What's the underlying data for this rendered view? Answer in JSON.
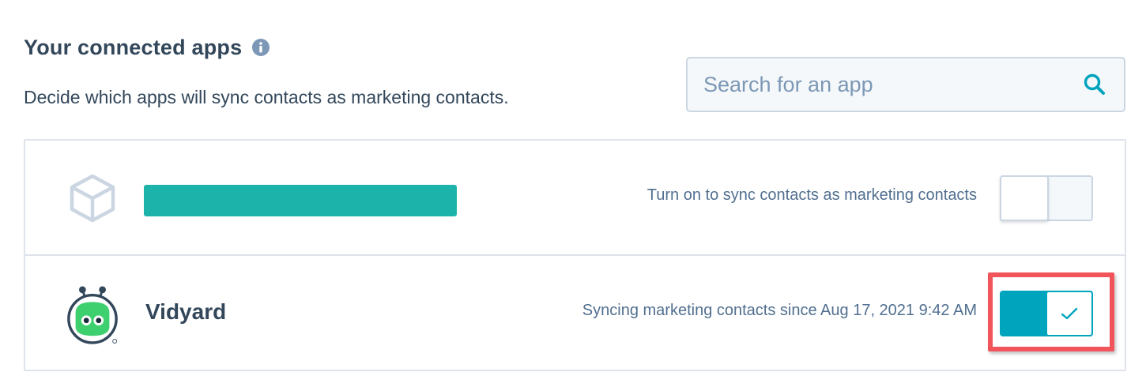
{
  "header": {
    "title": "Your connected apps",
    "info_icon": "info-circle-icon",
    "subtitle": "Decide which apps will sync contacts as marketing contacts."
  },
  "search": {
    "placeholder": "Search for an app",
    "value": "",
    "icon": "search-icon"
  },
  "apps": [
    {
      "name": "",
      "name_redacted": true,
      "redaction_color": "#1cb4aa",
      "logo_icon": "cube-icon",
      "status": "Turn on to sync contacts as marketing contacts",
      "sync_enabled": false
    },
    {
      "name": "Vidyard",
      "logo_icon": "vidyard-robot-icon",
      "status": "Syncing marketing contacts since Aug 17, 2021 9:42 AM",
      "sync_enabled": true,
      "highlighted": true
    }
  ],
  "colors": {
    "text_primary": "#33475b",
    "text_secondary": "#516f90",
    "accent": "#00a4bd",
    "border": "#dfe3eb",
    "highlight": "#f2545b",
    "vidyard_green": "#3ecf6e"
  }
}
